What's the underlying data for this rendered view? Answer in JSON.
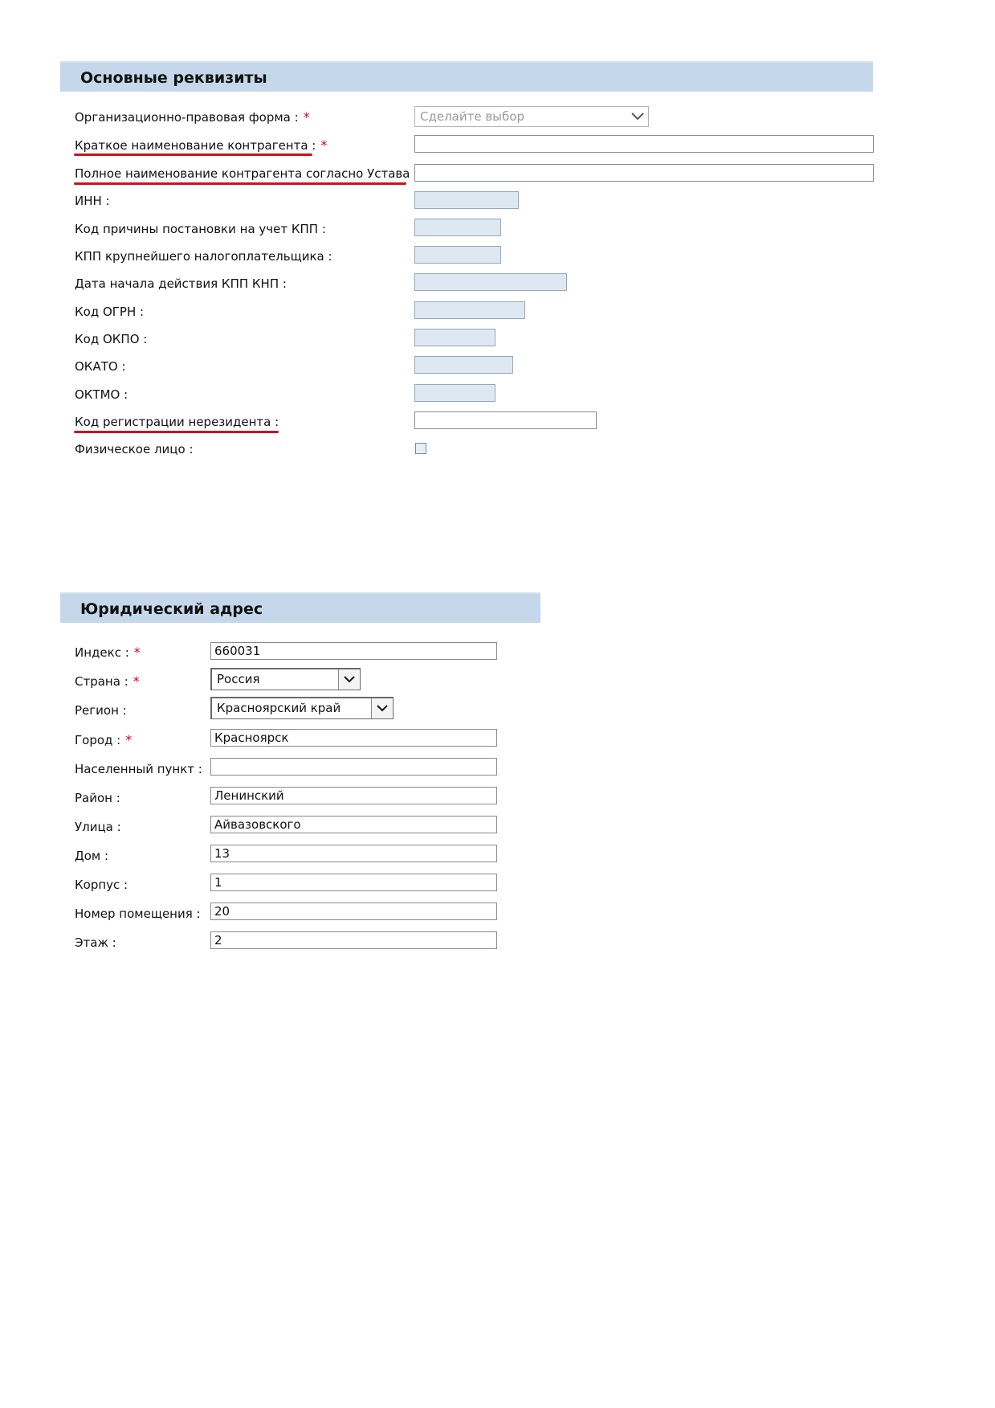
{
  "sections": {
    "main": {
      "title": "Основные реквизиты"
    },
    "address": {
      "title": "Юридический адрес"
    }
  },
  "main_fields": {
    "org_form": {
      "label": "Организационно-правовая форма :",
      "placeholder": "Сделайте выбор",
      "required": "*"
    },
    "short_name": {
      "label": "Краткое наименование контрагента :",
      "value": "",
      "required": "*"
    },
    "full_name": {
      "label": "Полное наименование контрагента согласно Устава :",
      "value": ""
    },
    "inn": {
      "label": "ИНН :",
      "value": ""
    },
    "kpp": {
      "label": "Код причины постановки на учет КПП :",
      "value": ""
    },
    "kpp_major": {
      "label": "КПП крупнейшего налогоплательщика :",
      "value": ""
    },
    "kpp_date": {
      "label": "Дата начала действия КПП КНП :",
      "value": ""
    },
    "ogrn": {
      "label": "Код ОГРН :",
      "value": ""
    },
    "okpo": {
      "label": "Код ОКПО :",
      "value": ""
    },
    "okato": {
      "label": "ОКАТО :",
      "value": ""
    },
    "oktmo": {
      "label": "ОКТМО :",
      "value": ""
    },
    "nonresident": {
      "label": "Код регистрации нерезидента :",
      "value": ""
    },
    "individual": {
      "label": "Физическое лицо :",
      "checked": false
    }
  },
  "address_fields": {
    "index": {
      "label": "Индекс :",
      "value": "660031",
      "required": "*"
    },
    "country": {
      "label": "Страна :",
      "value": "Россия",
      "required": "*"
    },
    "region": {
      "label": "Регион :",
      "value": "Красноярский край"
    },
    "city": {
      "label": "Город :",
      "value": "Красноярск",
      "required": "*"
    },
    "settlement": {
      "label": "Населенный пункт :",
      "value": ""
    },
    "district": {
      "label": "Район :",
      "value": "Ленинский"
    },
    "street": {
      "label": "Улица :",
      "value": "Айвазовского"
    },
    "house": {
      "label": "Дом :",
      "value": "13"
    },
    "building": {
      "label": "Корпус :",
      "value": "1"
    },
    "room": {
      "label": "Номер помещения :",
      "value": "20"
    },
    "floor": {
      "label": "Этаж :",
      "value": "2"
    }
  },
  "colors": {
    "header_bg": "#c5d7ea",
    "readonly_bg": "#dde8f3",
    "required": "#d0021b",
    "annotation_underline": "#d0111b"
  },
  "icons": {
    "dropdown": "chevron-down-icon"
  }
}
